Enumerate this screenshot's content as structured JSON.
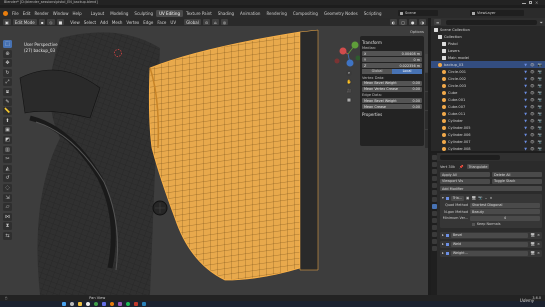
{
  "window": {
    "title": "Blender* [D:\\blender_sessions\\pistol_EN_backup.blend]"
  },
  "menu": {
    "items": [
      "File",
      "Edit",
      "Render",
      "Window",
      "Help"
    ],
    "workspaces": [
      "Layout",
      "Modeling",
      "Sculpting",
      "UV Editing",
      "Texture Paint",
      "Shading",
      "Animation",
      "Rendering",
      "Compositing",
      "Geometry Nodes",
      "Scripting"
    ],
    "active_workspace": "UV Editing",
    "scene": "Scene",
    "view_layer": "ViewLayer"
  },
  "viewport": {
    "mode": "Edit Mode",
    "menus": [
      "View",
      "Select",
      "Add",
      "Mesh",
      "Vertex",
      "Edge",
      "Face",
      "UV"
    ],
    "orientation": "Global",
    "perspective": "User Perspective",
    "object_info": "(27) backup_03",
    "options_label": "Options",
    "tools": [
      "select-icon",
      "cursor-icon",
      "move-icon",
      "rotate-icon",
      "scale-icon",
      "transform-icon",
      "annotate-icon",
      "measure-icon",
      "extrude-icon",
      "inset-icon",
      "bevel-icon",
      "loopcut-icon",
      "knife-icon",
      "polybuild-icon",
      "spin-icon",
      "smooth-icon",
      "shrink-icon",
      "shear-icon",
      "rip-icon"
    ]
  },
  "npanel": {
    "title": "Transform",
    "median_label": "Median:",
    "fields": [
      {
        "axis": "X",
        "value": "0.00408 m"
      },
      {
        "axis": "Y",
        "value": "0 m"
      },
      {
        "axis": "Z",
        "value": "0.022356 m"
      }
    ],
    "space": [
      "Global",
      "Local"
    ],
    "vertex_data": "Vertex Data:",
    "vertex_fields": [
      {
        "label": "Mean Bevel Weight",
        "value": "0.00"
      },
      {
        "label": "Mean Vertex Crease",
        "value": "0.00"
      }
    ],
    "edge_data": "Edge Data:",
    "edge_fields": [
      {
        "label": "Mean Bevel Weight",
        "value": "0.00"
      },
      {
        "label": "Mean Crease",
        "value": "0.00"
      }
    ],
    "properties": "Properties"
  },
  "outliner": {
    "items": [
      {
        "name": "Scene Collection"
      },
      {
        "name": "Collection"
      },
      {
        "name": "Pistol"
      },
      {
        "name": "Lasers"
      },
      {
        "name": "Main model"
      },
      {
        "name": "backup_03"
      },
      {
        "name": "Circle.001"
      },
      {
        "name": "Circle.002"
      },
      {
        "name": "Circle.003"
      },
      {
        "name": "Cube"
      },
      {
        "name": "Cube.001"
      },
      {
        "name": "Cube.007"
      },
      {
        "name": "Cube.011"
      },
      {
        "name": "Cylinder"
      },
      {
        "name": "Cylinder.005"
      },
      {
        "name": "Cylinder.006"
      },
      {
        "name": "Cylinder.007"
      },
      {
        "name": "Cylinder.008"
      }
    ]
  },
  "properties": {
    "stats": "Vert 30k",
    "modifier_tab": "Triangulate",
    "apply_all": "Apply All",
    "delete_all": "Delete All",
    "viewport_vis": "Viewport Vis",
    "toggle_stack": "Toggle Stack",
    "add_modifier": "Add Modifier",
    "triangulate_name": "Tria...",
    "quad_method_label": "Quad Method",
    "quad_method_value": "Shortest Diagonal",
    "ngon_method_label": "N-gon Method",
    "ngon_method_value": "Beauty",
    "min_vertices_label": "Minimum Ver...",
    "min_vertices_value": "4",
    "keep_normals": "Keep Normals",
    "modifiers": [
      "Bevel",
      "Weld",
      "Weight..."
    ]
  },
  "status": {
    "label": "Pan View",
    "version": "3.6.0"
  },
  "watermark": "Udemy"
}
